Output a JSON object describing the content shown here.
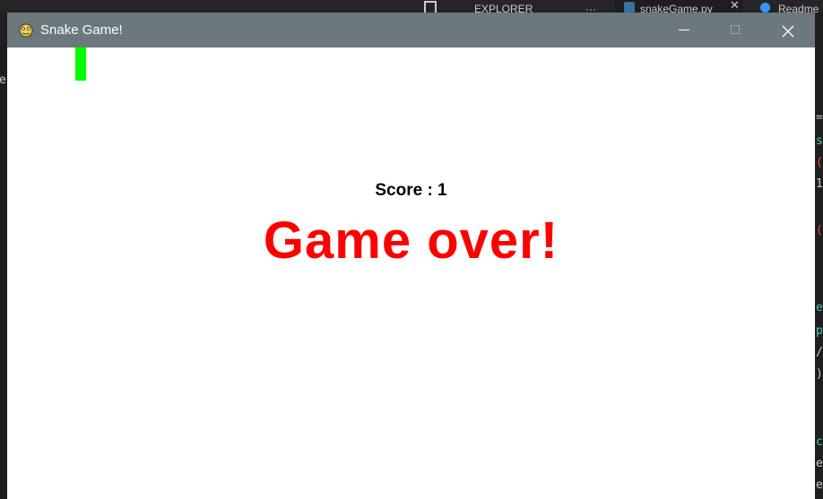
{
  "background_ide": {
    "tabs": [
      {
        "label": "EXPLORER",
        "icon": "files-icon"
      },
      {
        "label": "snakeGame.py",
        "icon": "python-file-icon"
      },
      {
        "label": "Readme",
        "icon": "info-icon"
      }
    ],
    "explorer_more": "···"
  },
  "window": {
    "title": "Snake Game!",
    "icon": "pygame-snake-icon",
    "controls": [
      "minimize-icon",
      "maximize-icon",
      "close-icon"
    ]
  },
  "game": {
    "score_text": "Score : 1",
    "game_over_text": "Game over!",
    "colors": {
      "snake": "#00ff00",
      "game_over": "#ff0000",
      "score": "#000000",
      "background": "#ffffff"
    }
  }
}
